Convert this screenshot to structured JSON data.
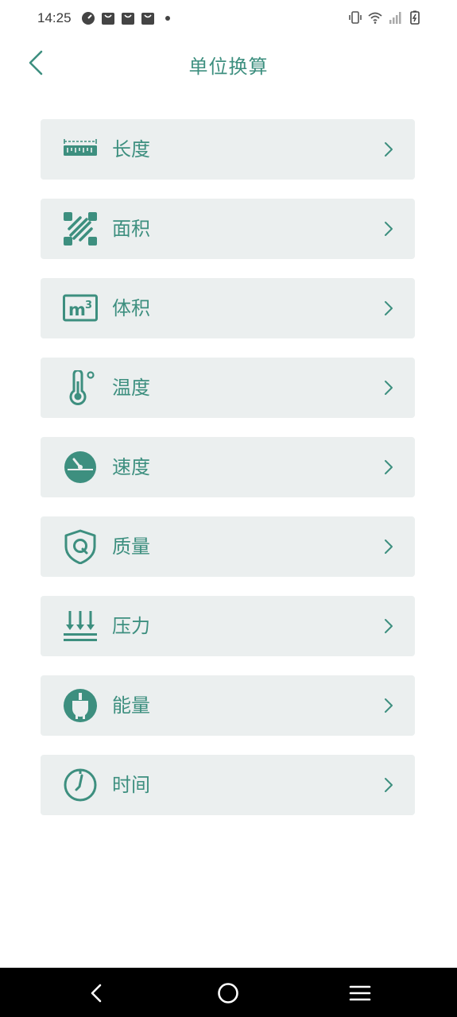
{
  "status_bar": {
    "time": "14:25"
  },
  "header": {
    "title": "单位换算"
  },
  "units": [
    {
      "label": "长度",
      "icon": "ruler-icon"
    },
    {
      "label": "面积",
      "icon": "area-icon"
    },
    {
      "label": "体积",
      "icon": "cubic-meter-icon"
    },
    {
      "label": "温度",
      "icon": "thermometer-icon"
    },
    {
      "label": "速度",
      "icon": "speedometer-icon"
    },
    {
      "label": "质量",
      "icon": "shield-q-icon"
    },
    {
      "label": "压力",
      "icon": "pressure-arrows-icon"
    },
    {
      "label": "能量",
      "icon": "plug-icon"
    },
    {
      "label": "时间",
      "icon": "clock-icon"
    }
  ],
  "colors": {
    "accent": "#3d8f7f",
    "card": "#ebefef",
    "nav": "#000000"
  }
}
